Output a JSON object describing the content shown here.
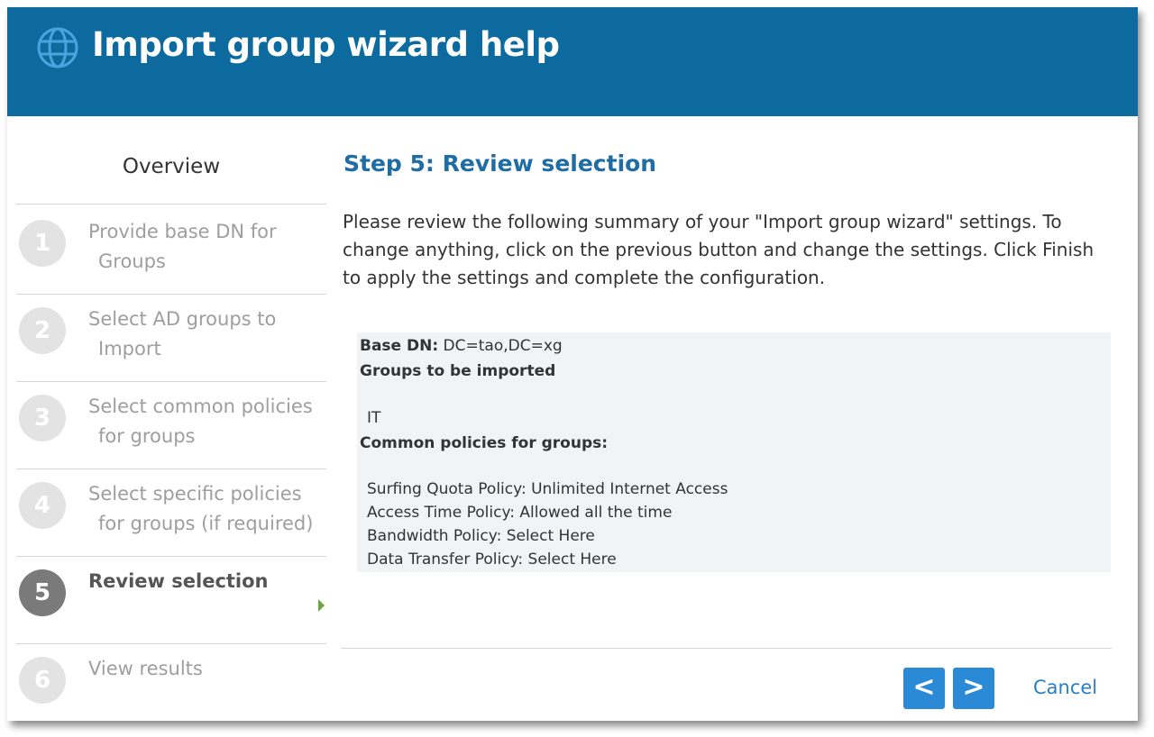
{
  "header": {
    "title": "Import group wizard help",
    "icon": "globe-icon",
    "bg_color": "#0c6a9e"
  },
  "sidebar": {
    "overview_label": "Overview",
    "steps": [
      {
        "num": "1",
        "line1": "Provide base DN for",
        "line2": "Groups",
        "active": false
      },
      {
        "num": "2",
        "line1": "Select AD groups to",
        "line2": "Import",
        "active": false
      },
      {
        "num": "3",
        "line1": "Select common policies",
        "line2": "for groups",
        "active": false
      },
      {
        "num": "4",
        "line1": "Select specific policies",
        "line2": "for groups (if required)",
        "active": false
      },
      {
        "num": "5",
        "line1": "Review selection",
        "line2": "",
        "active": true
      },
      {
        "num": "6",
        "line1": "View results",
        "line2": "",
        "active": false
      }
    ]
  },
  "main": {
    "heading": "Step 5: Review selection",
    "intro": "Please review the following summary of your \"Import group wizard\" settings. To change anything, click on the previous button and change the settings. Click Finish to apply the settings and complete the configuration.",
    "summary": {
      "base_dn_label": "Base DN:",
      "base_dn_value": " DC=tao,DC=xg",
      "groups_label": "Groups to be imported",
      "group_item": "IT",
      "common_label": "Common policies for groups:",
      "policies": [
        "Surfing Quota Policy: Unlimited Internet Access",
        "Access Time Policy: Allowed all the time",
        "Bandwidth Policy: Select Here",
        "Data Transfer Policy: Select Here"
      ]
    }
  },
  "footer": {
    "prev_label": "<",
    "next_label": ">",
    "cancel_label": "Cancel",
    "button_color": "#2b8ad6"
  }
}
